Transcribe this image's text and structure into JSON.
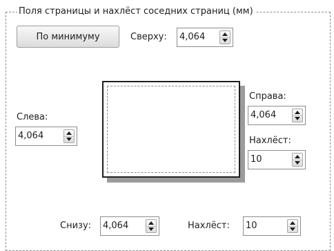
{
  "group": {
    "legend": "Поля страницы и нахлёст соседних страниц (мм)"
  },
  "min_button": {
    "label": "По минимуму"
  },
  "top": {
    "label": "Сверху:",
    "value": "4,064"
  },
  "left": {
    "label": "Слева:",
    "value": "4,064"
  },
  "right": {
    "label": "Справа:",
    "value": "4,064"
  },
  "right_overlap": {
    "label": "Нахлёст:",
    "value": "10"
  },
  "bottom": {
    "label": "Снизу:",
    "value": "4,064"
  },
  "bottom_overlap": {
    "label": "Нахлёст:",
    "value": "10"
  }
}
